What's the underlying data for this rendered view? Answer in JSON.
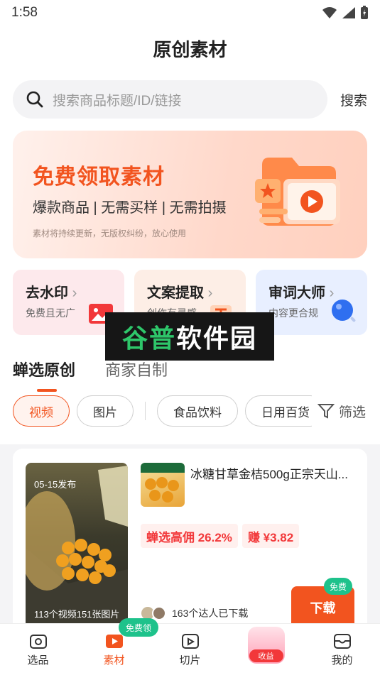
{
  "status_bar": {
    "time": "1:58"
  },
  "header": {
    "title": "原创素材"
  },
  "search": {
    "placeholder": "搜索商品标题/ID/链接",
    "action_label": "搜索"
  },
  "banner": {
    "title": "免费领取素材",
    "subtitle": "爆款商品 | 无需买样 | 无需拍摄",
    "note": "素材将持续更新，无版权纠纷，放心使用"
  },
  "tools": [
    {
      "title": "去水印",
      "subtitle": "免费且无广"
    },
    {
      "title": "文案提取",
      "subtitle": "创作有灵感"
    },
    {
      "title": "审词大师",
      "subtitle": "内容更合规"
    }
  ],
  "watermark": {
    "text_green": "谷普",
    "text_white": "软件园"
  },
  "content_tabs": [
    "蝉选原创",
    "商家自制"
  ],
  "filters": {
    "chips": [
      "视频",
      "图片",
      "食品饮料",
      "日用百货"
    ],
    "filter_label": "筛选"
  },
  "product_card": {
    "publish_date": "05-15发布",
    "media_count": "113个视频151张图片",
    "title": "冰糖甘草金桔500g正宗天山...",
    "commission_tag": "蝉选高佣 26.2%",
    "earn_tag": "赚 ¥3.82",
    "download_count": "163个达人已下载",
    "download_label": "下载",
    "free_badge": "免费"
  },
  "tabbar": {
    "items": [
      "选品",
      "素材",
      "切片",
      "收益",
      "我的"
    ],
    "badge": "免费领"
  },
  "colors": {
    "accent": "#f2541f",
    "green": "#1ec28b",
    "red": "#f2383a"
  }
}
